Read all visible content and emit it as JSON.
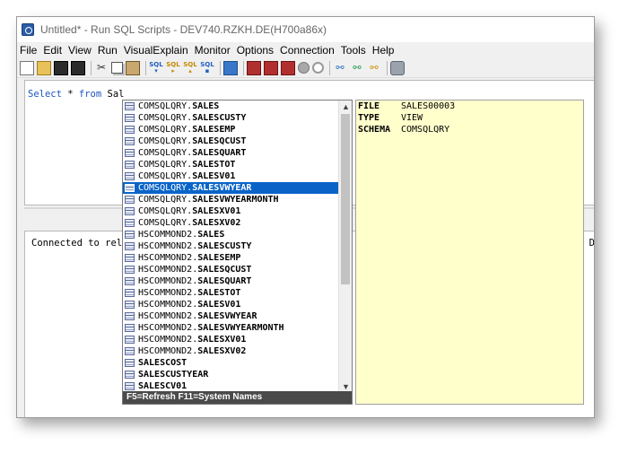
{
  "window": {
    "title": "Untitled* - Run SQL Scripts - DEV740.RZKH.DE(H700a86x)"
  },
  "menu": [
    "File",
    "Edit",
    "View",
    "Run",
    "VisualExplain",
    "Monitor",
    "Options",
    "Connection",
    "Tools",
    "Help"
  ],
  "editor": {
    "kw_select": "Select",
    "star": " * ",
    "kw_from": "from",
    "rest": " Sal"
  },
  "messages": {
    "text": "Connected to rela",
    "right_fragment": "D"
  },
  "completion": {
    "items": [
      {
        "prefix": "COMSQLQRY.",
        "name": "SALES"
      },
      {
        "prefix": "COMSQLQRY.",
        "name": "SALESCUSTY"
      },
      {
        "prefix": "COMSQLQRY.",
        "name": "SALESEMP"
      },
      {
        "prefix": "COMSQLQRY.",
        "name": "SALESQCUST"
      },
      {
        "prefix": "COMSQLQRY.",
        "name": "SALESQUART"
      },
      {
        "prefix": "COMSQLQRY.",
        "name": "SALESTOT"
      },
      {
        "prefix": "COMSQLQRY.",
        "name": "SALESV01"
      },
      {
        "prefix": "COMSQLQRY.",
        "name": "SALESVWYEAR"
      },
      {
        "prefix": "COMSQLQRY.",
        "name": "SALESVWYEARMONTH"
      },
      {
        "prefix": "COMSQLQRY.",
        "name": "SALESXV01"
      },
      {
        "prefix": "COMSQLQRY.",
        "name": "SALESXV02"
      },
      {
        "prefix": "HSCOMMOND2.",
        "name": "SALES"
      },
      {
        "prefix": "HSCOMMOND2.",
        "name": "SALESCUSTY"
      },
      {
        "prefix": "HSCOMMOND2.",
        "name": "SALESEMP"
      },
      {
        "prefix": "HSCOMMOND2.",
        "name": "SALESQCUST"
      },
      {
        "prefix": "HSCOMMOND2.",
        "name": "SALESQUART"
      },
      {
        "prefix": "HSCOMMOND2.",
        "name": "SALESTOT"
      },
      {
        "prefix": "HSCOMMOND2.",
        "name": "SALESV01"
      },
      {
        "prefix": "HSCOMMOND2.",
        "name": "SALESVWYEAR"
      },
      {
        "prefix": "HSCOMMOND2.",
        "name": "SALESVWYEARMONTH"
      },
      {
        "prefix": "HSCOMMOND2.",
        "name": "SALESXV01"
      },
      {
        "prefix": "HSCOMMOND2.",
        "name": "SALESXV02"
      },
      {
        "prefix": "",
        "name": "SALESCOST"
      },
      {
        "prefix": "",
        "name": "SALESCUSTYEAR"
      },
      {
        "prefix": "",
        "name": "SALESCV01"
      }
    ],
    "selected_index": 7,
    "status": "F5=Refresh  F11=System Names"
  },
  "detail": [
    {
      "key": "FILE",
      "value": "SALES00003"
    },
    {
      "key": "TYPE",
      "value": "VIEW"
    },
    {
      "key": "SCHEMA",
      "value": "COMSQLQRY"
    }
  ],
  "toolbar_labels": {
    "sql": "SQL"
  }
}
